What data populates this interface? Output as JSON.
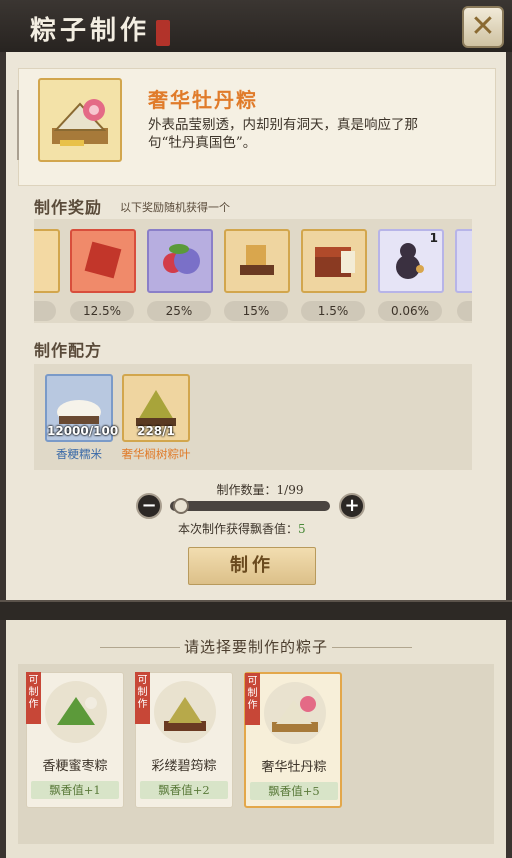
{
  "header": {
    "title": "粽子制作"
  },
  "item": {
    "name": "奢华牡丹粽",
    "description": "外表品莹剔透，内却别有洞天，真是响应了那句“牡丹真国色”。"
  },
  "rewards": {
    "title": "制作奖励",
    "subtitle": "以下奖励随机获得一个",
    "items": [
      {
        "pct": "12.5%",
        "icon": "red-gift-box-icon"
      },
      {
        "pct": "25%",
        "icon": "purple-fruit-icon"
      },
      {
        "pct": "15%",
        "icon": "puzzle-ornament-icon"
      },
      {
        "pct": "1.5%",
        "icon": "treasure-chest-icon"
      },
      {
        "pct": "0.06%",
        "icon": "gold-gourd-icon",
        "count": "1"
      }
    ]
  },
  "recipe": {
    "title": "制作配方",
    "materials": [
      {
        "name": "香粳糯米",
        "count": "12000/100"
      },
      {
        "name": "奢华榈树粽叶",
        "count": "228/1"
      }
    ]
  },
  "craft": {
    "qty_label": "制作数量：1/99",
    "quantity_fraction": 0.0101,
    "earn_label": "本次制作获得飘香值：",
    "earn_value": "5",
    "make_label": "制作"
  },
  "selector": {
    "title": "请选择要制作的粽子",
    "cards": [
      {
        "badge": "可制作",
        "name": "香粳蜜枣粽",
        "value": "飘香值+1",
        "selected": false
      },
      {
        "badge": "可制作",
        "name": "彩缕碧�londons粽",
        "value": "飘香值+2",
        "selected": false
      },
      {
        "badge": "可制作",
        "name": "奢华牡丹粽",
        "value": "飘香值+5",
        "selected": true
      }
    ]
  },
  "colors": {
    "accent": "#e07b2a",
    "button": "#dcc089",
    "badge": "#c74737"
  }
}
